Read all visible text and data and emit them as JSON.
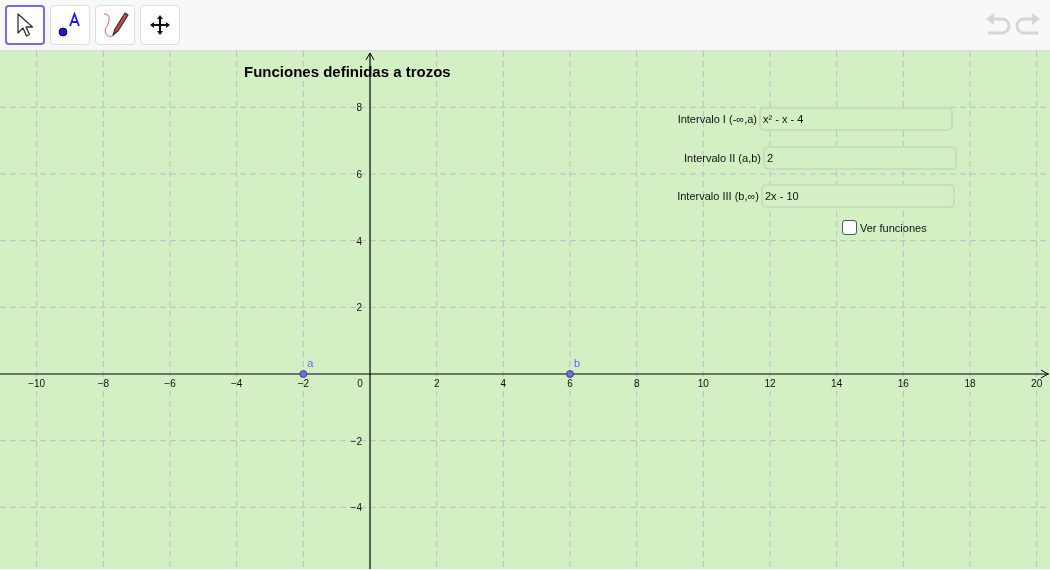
{
  "toolbar": {
    "tools": [
      {
        "selected": true
      },
      {
        "selected": false
      },
      {
        "selected": false
      },
      {
        "selected": false
      }
    ],
    "undo": {
      "disabled": true
    },
    "redo": {
      "disabled": true
    }
  },
  "graphics": {
    "title": "Funciones definidas a trozos",
    "inputs": [
      {
        "label": "Intervalo I (-∞,a)",
        "value": "x² - x - 4"
      },
      {
        "label": "Intervalo II (a,b)",
        "value": "2"
      },
      {
        "label": "Intervalo III (b,∞)",
        "value": "2x - 10"
      }
    ],
    "checkbox": {
      "label": "Ver funciones",
      "checked": false
    },
    "origin_label": "0",
    "chart_data": {
      "type": "scatter",
      "grid": true,
      "x": [
        -2,
        6
      ],
      "values": [
        0,
        0
      ],
      "xlim": [
        -11.1,
        20.4
      ],
      "ylim": [
        -5.85,
        9.69
      ],
      "xticks": [
        {
          "value": -10,
          "label": "−10"
        },
        {
          "value": -8,
          "label": "−8"
        },
        {
          "value": -6,
          "label": "−6"
        },
        {
          "value": -4,
          "label": "−4"
        },
        {
          "value": -2,
          "label": "−2"
        },
        {
          "value": 2,
          "label": "2"
        },
        {
          "value": 4,
          "label": "4"
        },
        {
          "value": 6,
          "label": "6"
        },
        {
          "value": 8,
          "label": "8"
        },
        {
          "value": 10,
          "label": "10"
        },
        {
          "value": 12,
          "label": "12"
        },
        {
          "value": 14,
          "label": "14"
        },
        {
          "value": 16,
          "label": "16"
        },
        {
          "value": 18,
          "label": "18"
        },
        {
          "value": 20,
          "label": "20"
        }
      ],
      "yticks": [
        {
          "value": 8,
          "label": "8"
        },
        {
          "value": 6,
          "label": "6"
        },
        {
          "value": 4,
          "label": "4"
        },
        {
          "value": 2,
          "label": "2"
        },
        {
          "value": -2,
          "label": "−2"
        },
        {
          "value": -4,
          "label": "−4"
        }
      ],
      "annotations": [
        {
          "x": -2,
          "y": 0,
          "text": "a"
        },
        {
          "x": 6,
          "y": 0,
          "text": "b"
        }
      ]
    }
  }
}
